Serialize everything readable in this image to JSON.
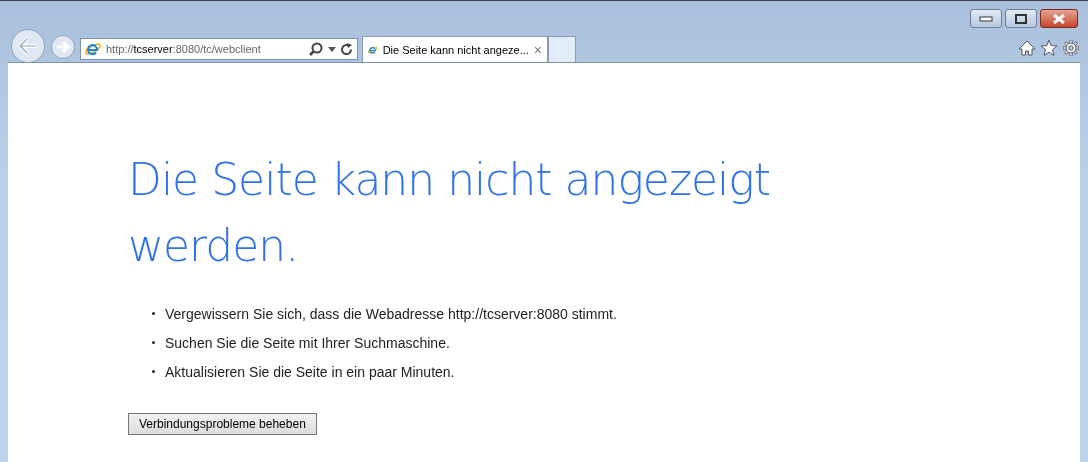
{
  "address_bar": {
    "url": "http://**tcserver**:8080/tc/webclient"
  },
  "tabs": [
    {
      "title": "Die Seite kann nicht angeze...",
      "close": "×",
      "selected": true
    }
  ],
  "page": {
    "heading": "Die Seite kann nicht angezeigt werden.",
    "tips": [
      "Vergewissern Sie sich, dass die Webadresse http://tcserver:8080 stimmt.",
      "Suchen Sie die Seite mit Ihrer Suchmaschine.",
      "Aktualisieren Sie die Seite in ein paar Minuten."
    ],
    "button": "Verbindungsprobleme beheben"
  }
}
